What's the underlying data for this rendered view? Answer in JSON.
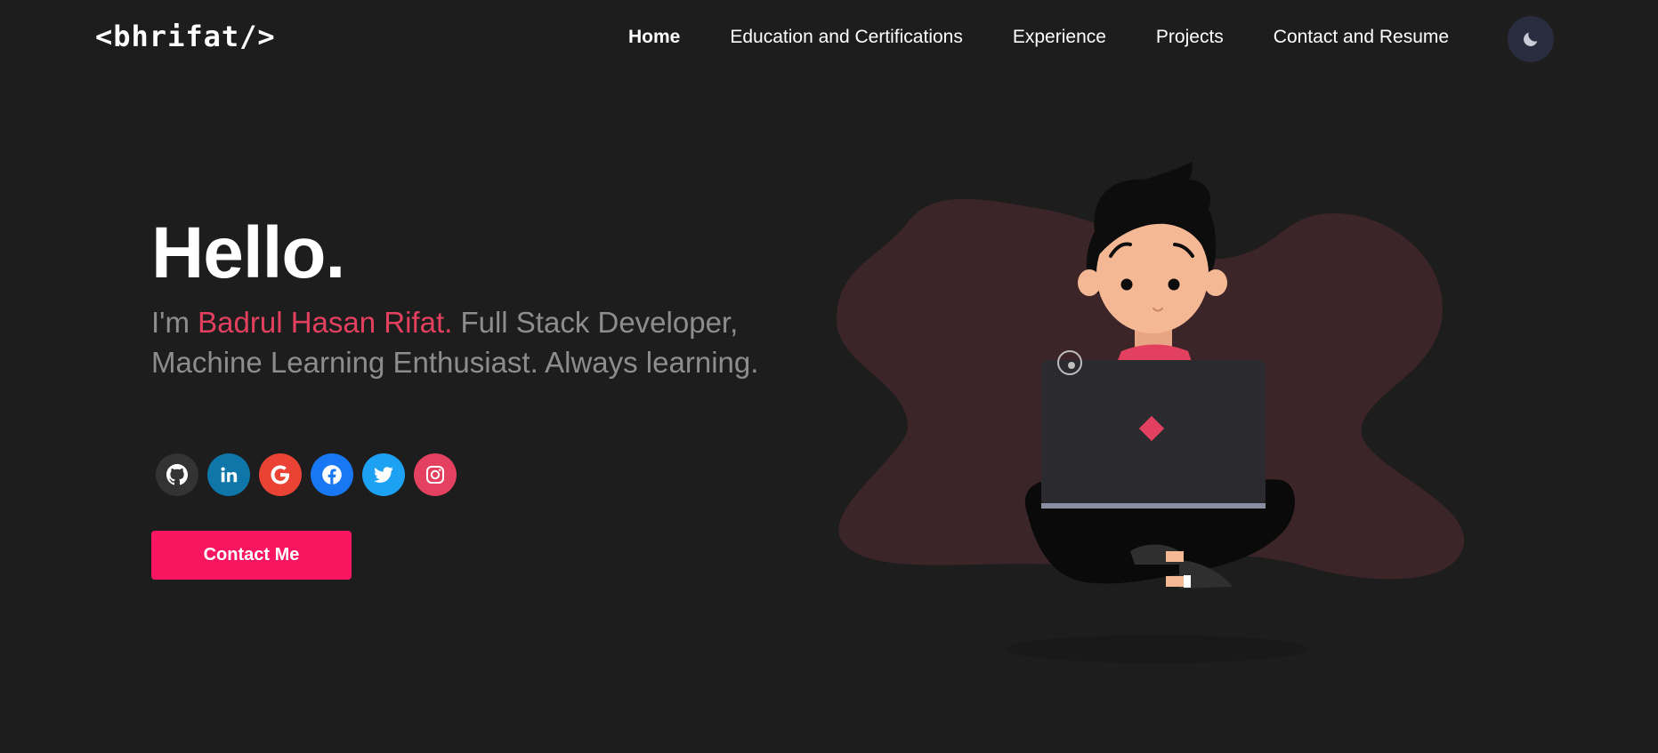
{
  "header": {
    "logo": "<bhrifat/>",
    "nav": [
      {
        "label": "Home",
        "active": true
      },
      {
        "label": "Education and Certifications"
      },
      {
        "label": "Experience"
      },
      {
        "label": "Projects"
      },
      {
        "label": "Contact and Resume"
      }
    ],
    "theme_toggle_icon": "moon-icon"
  },
  "hero": {
    "greeting": "Hello.",
    "intro_prefix": "I'm ",
    "name": "Badrul Hasan Rifat.",
    "intro_suffix": " Full Stack Developer, Machine Learning Enthusiast. Always learning.",
    "socials": [
      {
        "icon": "github-icon",
        "color": "#333333"
      },
      {
        "icon": "linkedin-icon",
        "color": "#0e76a8"
      },
      {
        "icon": "google-icon",
        "color": "#ea4335"
      },
      {
        "icon": "facebook-icon",
        "color": "#1877f2"
      },
      {
        "icon": "twitter-icon",
        "color": "#1da1f2"
      },
      {
        "icon": "instagram-icon",
        "color": "#e4405f"
      }
    ],
    "contact_button": "Contact Me"
  },
  "colors": {
    "background": "#1d1d1d",
    "accent": "#e3405f",
    "button": "#f7165f",
    "text_muted": "#8d8d8d",
    "blob": "#3c2528"
  }
}
